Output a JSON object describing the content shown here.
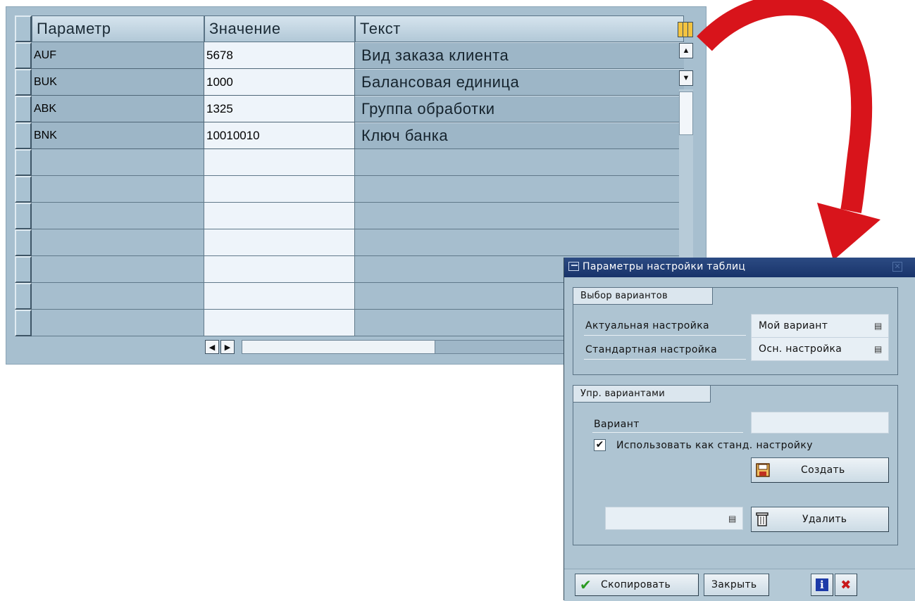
{
  "table": {
    "columns": [
      "Параметр",
      "Значение",
      "Текст"
    ],
    "rows": [
      {
        "param": "AUF",
        "value": "5678",
        "text": "Вид заказа клиента"
      },
      {
        "param": "BUK",
        "value": "1000",
        "text": "Балансовая единица"
      },
      {
        "param": "ABK",
        "value": "1325",
        "text": "Группа обработки"
      },
      {
        "param": "BNK",
        "value": "10010010",
        "text": "Ключ банка"
      }
    ],
    "empty_row_count": 7
  },
  "dialog": {
    "title": "Параметры настройки таблиц",
    "variant_selection": {
      "tab": "Выбор вариантов",
      "current_label": "Актуальная настройка",
      "current_value": "Мой вариант",
      "standard_label": "Стандартная настройка",
      "standard_value": "Осн. настройка"
    },
    "variant_management": {
      "tab": "Упр. вариантами",
      "variant_label": "Вариант",
      "variant_value": "",
      "use_as_standard_label": "Использовать как станд. настройку",
      "use_as_standard_checked": true,
      "create_label": "Создать",
      "delete_value": "",
      "delete_label": "Удалить"
    },
    "footer": {
      "copy_label": "Скопировать",
      "close_label": "Закрыть"
    }
  },
  "colors": {
    "arrow": "#d8141b",
    "titlebar": "#1f3b73",
    "table_bg": "#a7bfcf"
  }
}
